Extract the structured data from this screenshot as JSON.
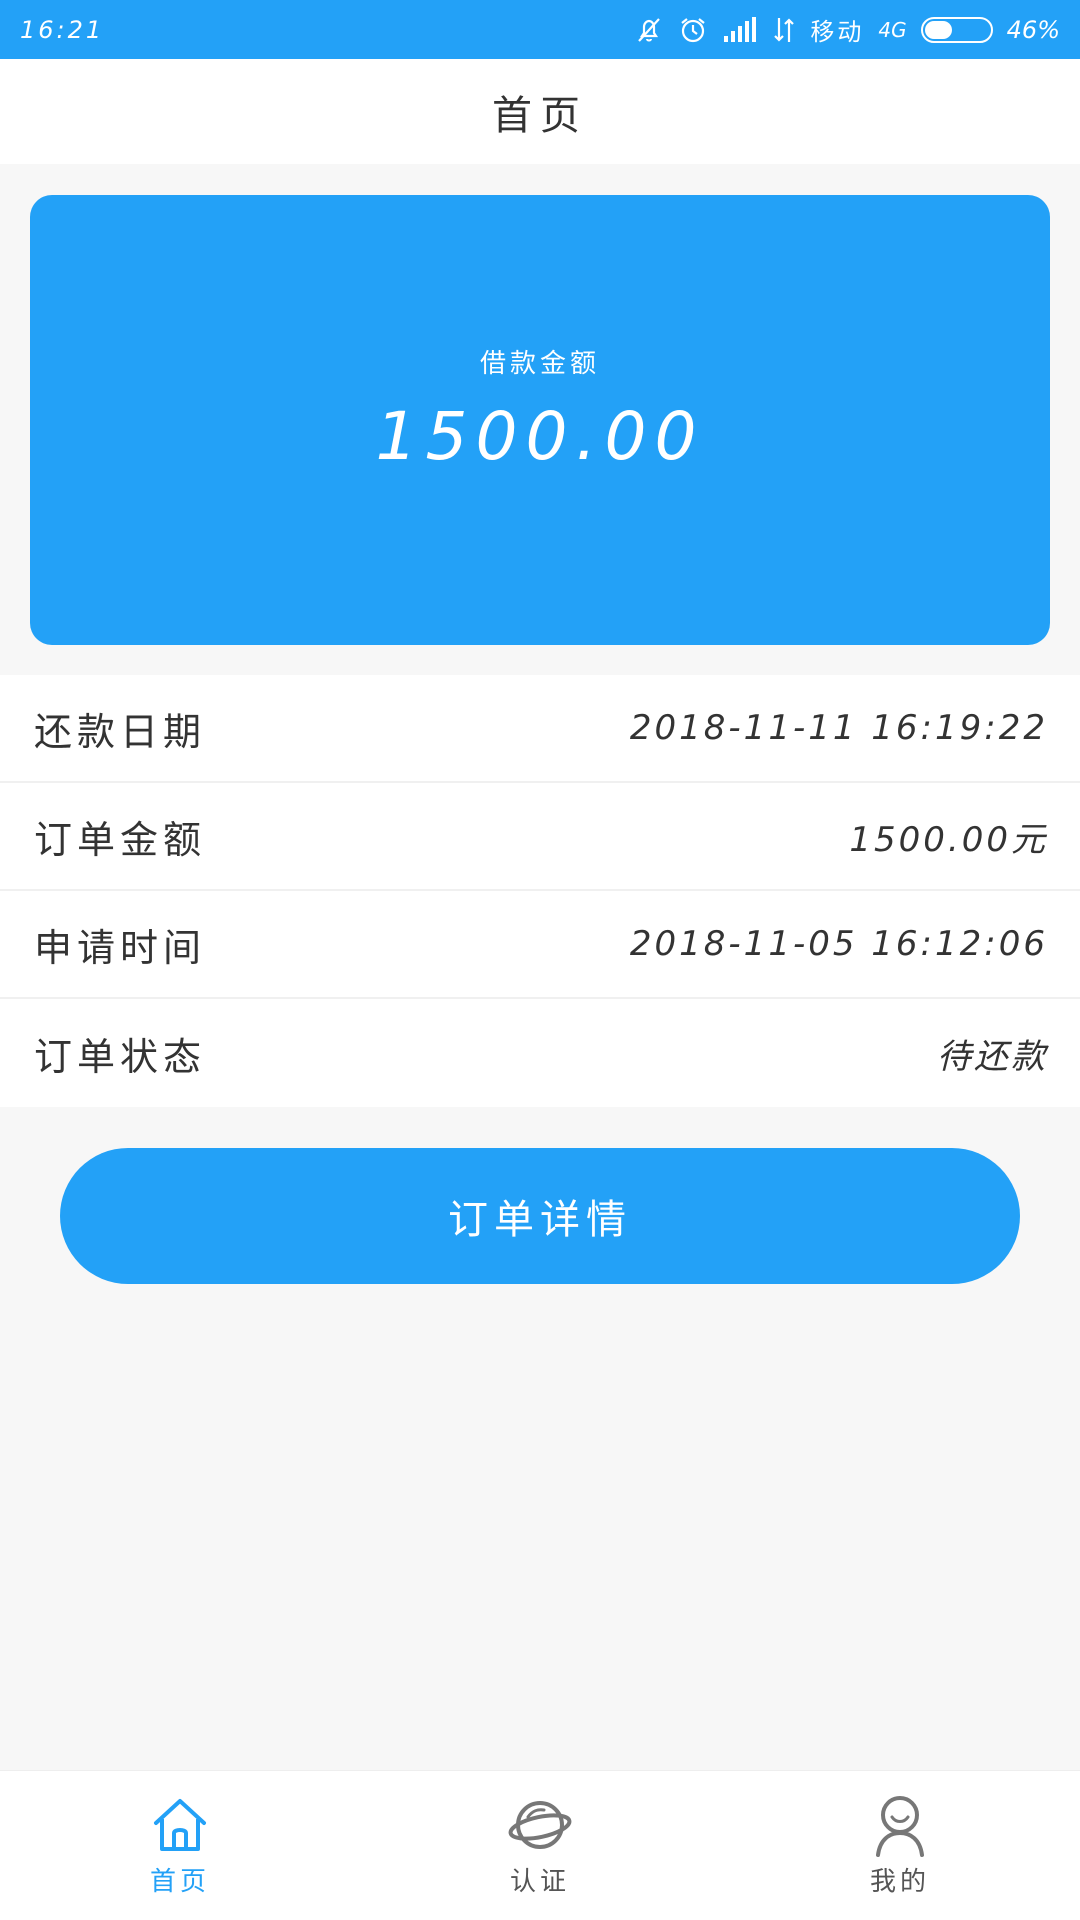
{
  "status_bar": {
    "time": "16:21",
    "carrier": "移动",
    "network": "4G",
    "battery_percent": "46%",
    "battery_level": 0.46
  },
  "header": {
    "title": "首页"
  },
  "loan_card": {
    "label": "借款金额",
    "amount": "1500.00"
  },
  "info": {
    "rows": [
      {
        "label": "还款日期",
        "value": "2018-11-11  16:19:22"
      },
      {
        "label": "订单金额",
        "value": "1500.00元"
      },
      {
        "label": "申请时间",
        "value": "2018-11-05  16:12:06"
      },
      {
        "label": "订单状态",
        "value": "待还款"
      }
    ]
  },
  "detail_button": {
    "label": "订单详情"
  },
  "bottom_nav": {
    "items": [
      {
        "label": "首页",
        "icon": "home-icon",
        "active": true
      },
      {
        "label": "认证",
        "icon": "planet-icon",
        "active": false
      },
      {
        "label": "我的",
        "icon": "person-icon",
        "active": false
      }
    ]
  },
  "colors": {
    "accent": "#23a1f7",
    "background": "#f7f7f7",
    "text": "#333333"
  }
}
